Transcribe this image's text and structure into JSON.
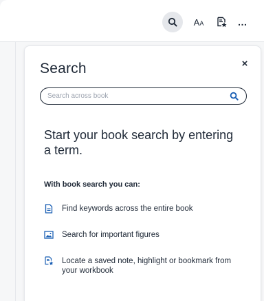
{
  "toolbar": {
    "search_icon": "search-icon",
    "text_size_icon": "text-size-icon",
    "text_size_label": "AA",
    "workbook_icon": "workbook-star-icon",
    "more_label": "…"
  },
  "panel": {
    "title": "Search",
    "close_label": "×",
    "search": {
      "placeholder": "Search across book",
      "value": ""
    },
    "empty_state": {
      "heading": "Start your book search by entering a term.",
      "subheading": "With book search you can:",
      "features": [
        {
          "icon": "document-icon",
          "text": "Find keywords across the entire book"
        },
        {
          "icon": "image-icon",
          "text": "Search for important figures"
        },
        {
          "icon": "note-star-icon",
          "text": "Locate a saved note, highlight or bookmark from your workbook"
        }
      ]
    }
  },
  "colors": {
    "accent": "#1a5fb4",
    "text": "#1f2937",
    "active_button_bg": "#e5e7eb"
  }
}
